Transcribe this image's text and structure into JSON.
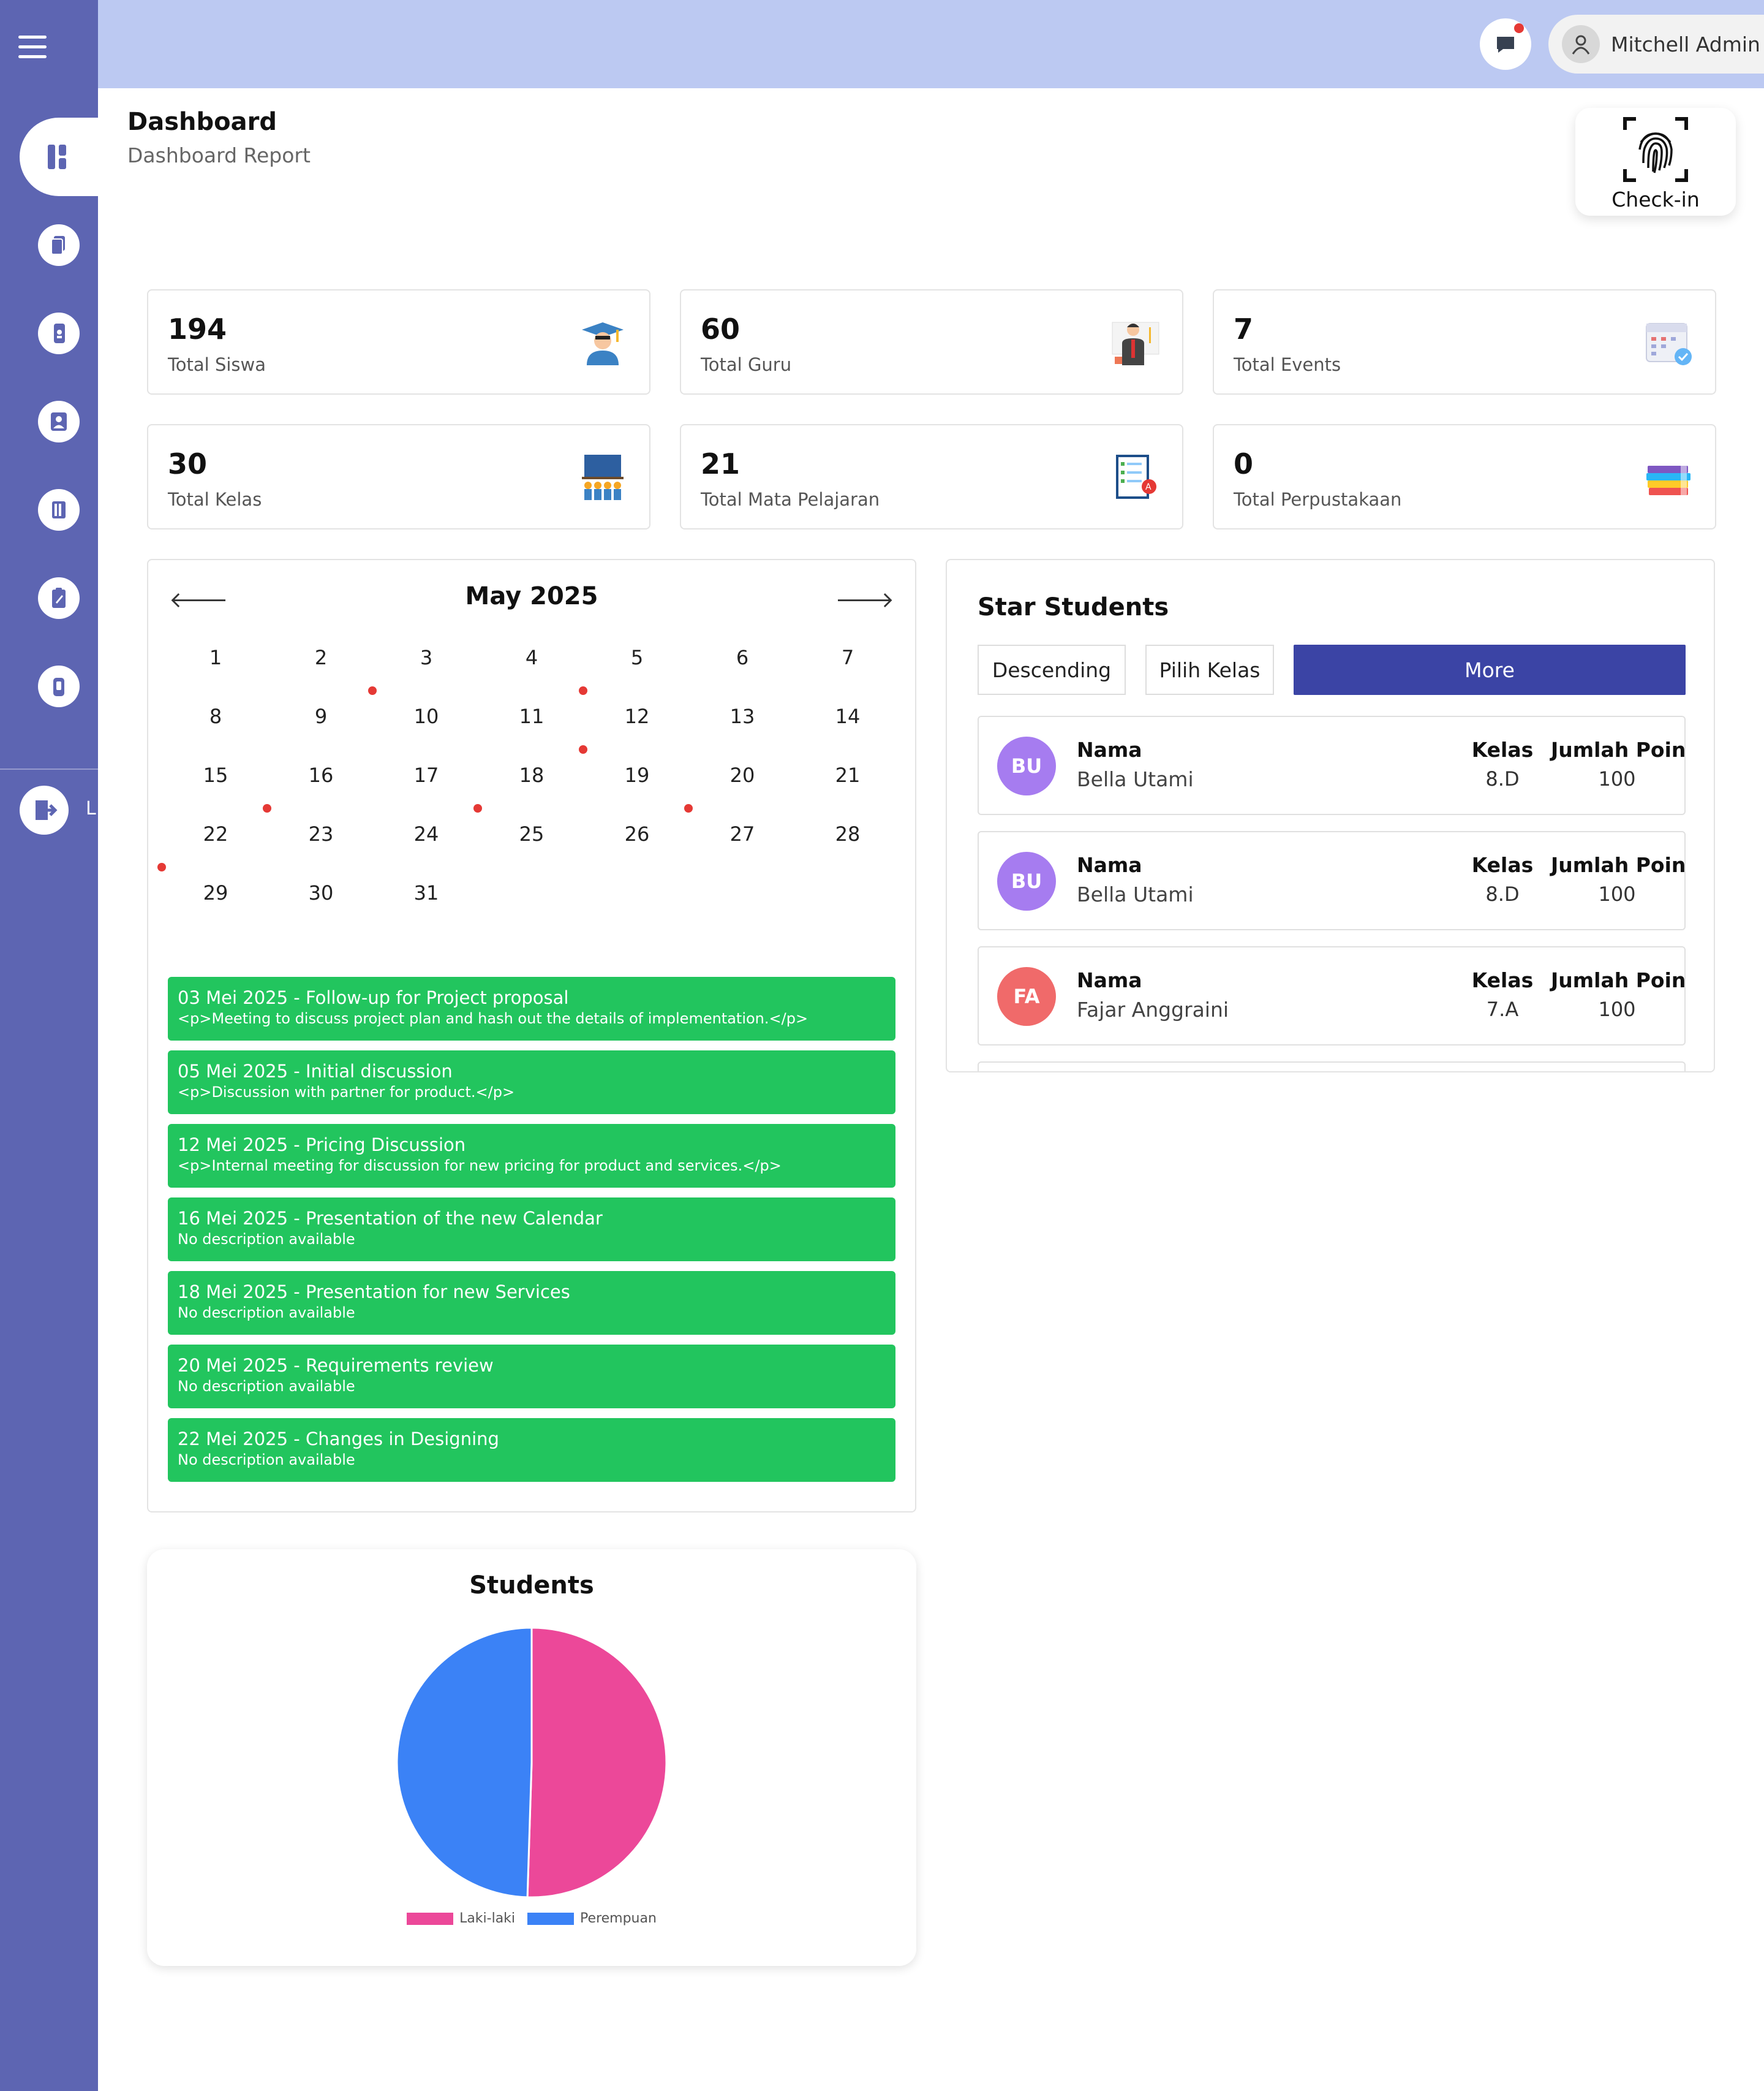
{
  "header": {
    "title": "Dashboard",
    "subtitle": "Dashboard Report",
    "checkin_label": "Check-in"
  },
  "topbar": {
    "user_name": "Mitchell Admin",
    "icons": [
      "chat-icon",
      "user-icon",
      "chevron-down-icon"
    ]
  },
  "sidebar": {
    "logout_label": "L",
    "icons": [
      "dashboard-icon",
      "copy-icon",
      "phone-icon",
      "teacher-icon",
      "library-icon",
      "clipboard-icon",
      "remote-icon",
      "logout-icon"
    ]
  },
  "stats": [
    {
      "value": "194",
      "label": "Total Siswa",
      "icon": "graduate-icon"
    },
    {
      "value": "60",
      "label": "Total Guru",
      "icon": "teacher-icon"
    },
    {
      "value": "7",
      "label": "Total Events",
      "icon": "calendar-icon"
    },
    {
      "value": "30",
      "label": "Total Kelas",
      "icon": "classroom-icon"
    },
    {
      "value": "21",
      "label": "Total Mata Pelajaran",
      "icon": "checklist-icon"
    },
    {
      "value": "0",
      "label": "Total Perpustakaan",
      "icon": "books-icon"
    }
  ],
  "calendar": {
    "title": "May 2025",
    "prev": "🡐",
    "next": "🡒",
    "days": [
      "1",
      "2",
      "3",
      "4",
      "5",
      "6",
      "7",
      "8",
      "9",
      "10",
      "11",
      "12",
      "13",
      "14",
      "15",
      "16",
      "17",
      "18",
      "19",
      "20",
      "21",
      "22",
      "23",
      "24",
      "25",
      "26",
      "27",
      "28",
      "29",
      "30",
      "31"
    ],
    "event_days": [
      3,
      5,
      12,
      16,
      18,
      20,
      22
    ]
  },
  "events": [
    {
      "title": "03 Mei 2025 - Follow-up for Project proposal",
      "desc": "<p>Meeting to discuss project plan and hash out the details of implementation.</p>"
    },
    {
      "title": "05 Mei 2025 - Initial discussion",
      "desc": "<p>Discussion with partner for product.</p>"
    },
    {
      "title": "12 Mei 2025 - Pricing Discussion",
      "desc": "<p>Internal meeting for discussion for new pricing for product and services.</p>"
    },
    {
      "title": "16 Mei 2025 - Presentation of the new Calendar",
      "desc": "No description available"
    },
    {
      "title": "18 Mei 2025 - Presentation for new Services",
      "desc": "No description available"
    },
    {
      "title": "20 Mei 2025 - Requirements review",
      "desc": "No description available"
    },
    {
      "title": "22 Mei 2025 - Changes in Designing",
      "desc": "No description available"
    }
  ],
  "star": {
    "title": "Star Students",
    "btn_sort": "Descending",
    "btn_class": "Pilih Kelas",
    "btn_more": "More",
    "students": [
      {
        "initials": "BU",
        "name_label": "Nama",
        "name": "Bella Utami",
        "kelas_label": "Kelas",
        "kelas": "8.D",
        "poin_label": "Jumlah Poin",
        "poin": "100",
        "color": "#a67cf0"
      },
      {
        "initials": "BU",
        "name_label": "Nama",
        "name": "Bella Utami",
        "kelas_label": "Kelas",
        "kelas": "8.D",
        "poin_label": "Jumlah Poin",
        "poin": "100",
        "color": "#a67cf0"
      },
      {
        "initials": "FA",
        "name_label": "Nama",
        "name": "Fajar Anggraini",
        "kelas_label": "Kelas",
        "kelas": "7.A",
        "poin_label": "Jumlah Poin",
        "poin": "100",
        "color": "#f06a6a"
      }
    ]
  },
  "chart_data": {
    "type": "pie",
    "title": "Students",
    "categories": [
      "Laki-laki",
      "Perempuan"
    ],
    "values": [
      50.5,
      49.5
    ],
    "colors": [
      "#ec4899",
      "#3b82f6"
    ],
    "legend": "bottom"
  },
  "colors": {
    "sidebar": "#5d65b2",
    "topbar": "#bcc9f2",
    "accent": "#3b44a5",
    "event": "#22c55e",
    "event_dot": "#e53935"
  }
}
